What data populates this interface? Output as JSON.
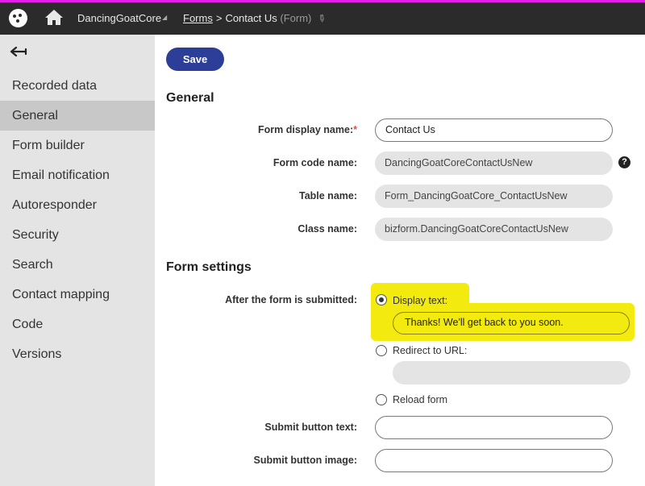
{
  "header": {
    "site_name": "DancingGoatCore",
    "breadcrumb_forms": "Forms",
    "breadcrumb_separator": ">",
    "breadcrumb_current": "Contact Us",
    "breadcrumb_type": "(Form)",
    "accent_color": "#e21ee8"
  },
  "sidebar": {
    "items": [
      {
        "label": "Recorded data"
      },
      {
        "label": "General",
        "active": true
      },
      {
        "label": "Form builder"
      },
      {
        "label": "Email notification"
      },
      {
        "label": "Autoresponder"
      },
      {
        "label": "Security"
      },
      {
        "label": "Search"
      },
      {
        "label": "Contact mapping"
      },
      {
        "label": "Code"
      },
      {
        "label": "Versions"
      }
    ]
  },
  "toolbar": {
    "save_label": "Save",
    "save_color": "#2c3e98"
  },
  "general": {
    "title": "General",
    "form_display_name_label": "Form display name:",
    "required_mark": "*",
    "form_display_name_value": "Contact Us",
    "form_code_name_label": "Form code name:",
    "form_code_name_value": "DancingGoatCoreContactUsNew",
    "help_glyph": "?",
    "table_name_label": "Table name:",
    "table_name_value": "Form_DancingGoatCore_ContactUsNew",
    "class_name_label": "Class name:",
    "class_name_value": "bizform.DancingGoatCoreContactUsNew"
  },
  "form_settings": {
    "title": "Form settings",
    "after_submit_label": "After the form is submitted:",
    "options": [
      {
        "label": "Display text:",
        "selected": true
      },
      {
        "label": "Redirect to URL:",
        "selected": false
      },
      {
        "label": "Reload form",
        "selected": false
      }
    ],
    "display_text_value": "Thanks! We'll get back to you soon.",
    "redirect_url_value": "",
    "submit_button_text_label": "Submit button text:",
    "submit_button_text_value": "",
    "submit_button_image_label": "Submit button image:",
    "submit_button_image_value": "",
    "highlight_color": "#f3ea0f"
  }
}
